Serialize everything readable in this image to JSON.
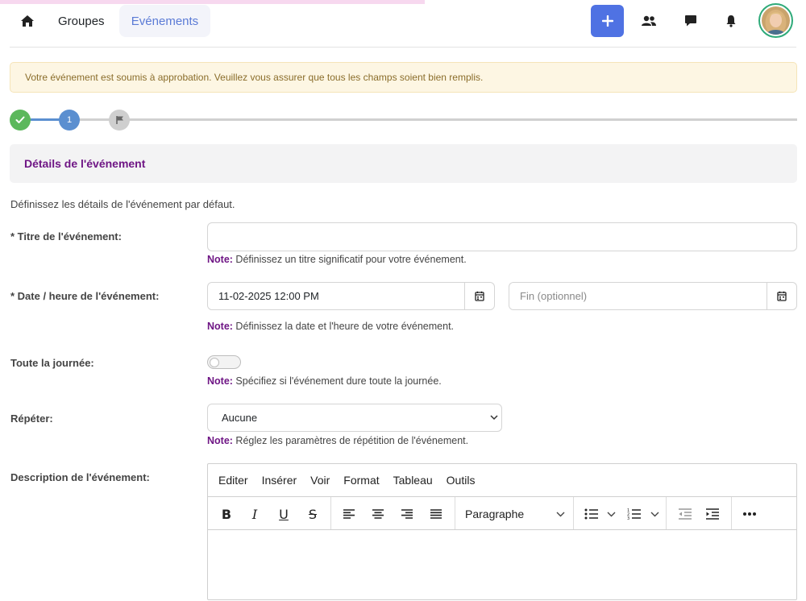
{
  "nav": {
    "groupes": "Groupes",
    "evenements": "Evénements"
  },
  "alert": {
    "text": "Votre événement est soumis à approbation. Veuillez vous assurer que tous les champs soient bien remplis."
  },
  "stepper": {
    "step2_number": "1"
  },
  "section": {
    "title": "Détails de l'événement",
    "intro": "Définissez les détails de l'événement par défaut."
  },
  "form": {
    "title_label": "* Titre de l'événement:",
    "title_value": "",
    "title_note_prefix": "Note:",
    "title_note": " Définissez un titre significatif pour votre événement.",
    "date_label": "* Date / heure de l'événement:",
    "date_start_value": "11-02-2025 12:00 PM",
    "date_end_placeholder": "Fin (optionnel)",
    "date_note_prefix": "Note:",
    "date_note": " Définissez la date et l'heure de votre événement.",
    "allday_label": "Toute la journée:",
    "allday_on": false,
    "allday_note_prefix": "Note:",
    "allday_note": " Spécifiez si l'événement dure toute la journée.",
    "repeat_label": "Répéter:",
    "repeat_value": "Aucune",
    "repeat_note_prefix": "Note:",
    "repeat_note": " Réglez les paramètres de répétition de l'événement.",
    "description_label": "Description de l'événement:"
  },
  "editor": {
    "menu": [
      "Editer",
      "Insérer",
      "Voir",
      "Format",
      "Tableau",
      "Outils"
    ],
    "block_format": "Paragraphe"
  },
  "colors": {
    "accent_blue": "#4f72e3",
    "success_green": "#5cb85c",
    "step_blue": "#5b8fd0",
    "label_purple": "#6f1685"
  }
}
